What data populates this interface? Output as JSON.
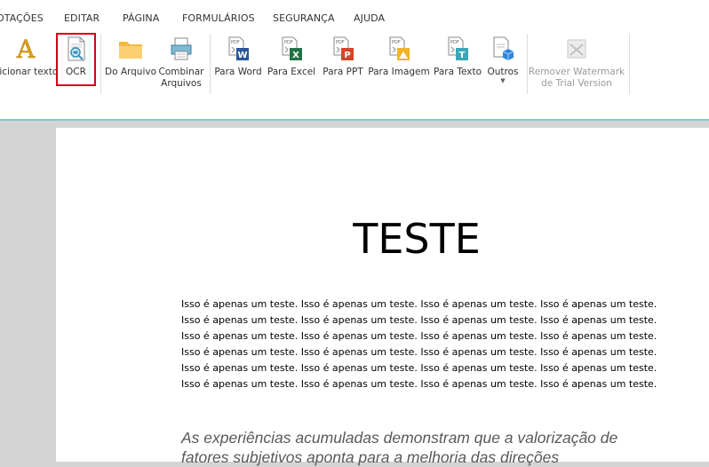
{
  "menu": {
    "items": [
      "OTAÇÕES",
      "EDITAR",
      "PÁGINA",
      "FORMULÁRIOS",
      "SEGURANÇA",
      "AJUDA"
    ]
  },
  "ribbon": {
    "add_text": "dicionar texto",
    "ocr": "OCR",
    "from_file": "Do Arquivo",
    "combine_1": "Combinar",
    "combine_2": "Arquivos",
    "to_word": "Para Word",
    "to_excel": "Para Excel",
    "to_ppt": "Para PPT",
    "to_image": "Para Imagem",
    "to_text": "Para Texto",
    "others": "Outros",
    "remove_wm_1": "Remover Watermark",
    "remove_wm_2": "de Trial Version"
  },
  "document": {
    "title": "TESTE",
    "paragraph_lines": [
      "Isso é apenas um teste. Isso é apenas um teste. Isso é apenas um teste. Isso é apenas um teste.",
      "Isso é apenas um teste. Isso é apenas um teste. Isso é apenas um teste. Isso é apenas um teste.",
      "Isso é apenas um teste. Isso é apenas um teste. Isso é apenas um teste. Isso é apenas um teste.",
      "Isso é apenas um teste. Isso é apenas um teste. Isso é apenas um teste. Isso é apenas um teste.",
      "Isso é apenas um teste. Isso é apenas um teste. Isso é apenas um teste. Isso é apenas um teste.",
      "Isso é apenas um teste. Isso é apenas um teste. Isso é apenas um teste. Isso é apenas um teste."
    ],
    "quote_lines": [
      "As experiências acumuladas demonstram que a valorização de",
      "fatores subjetivos aponta para a melhoria das direções"
    ]
  },
  "colors": {
    "highlight": "#d0021b",
    "accent_line": "#7fc6d4",
    "word": "#2b579a",
    "excel": "#217346",
    "ppt": "#d24726",
    "image": "#f0b429",
    "text": "#3aa6b9"
  }
}
